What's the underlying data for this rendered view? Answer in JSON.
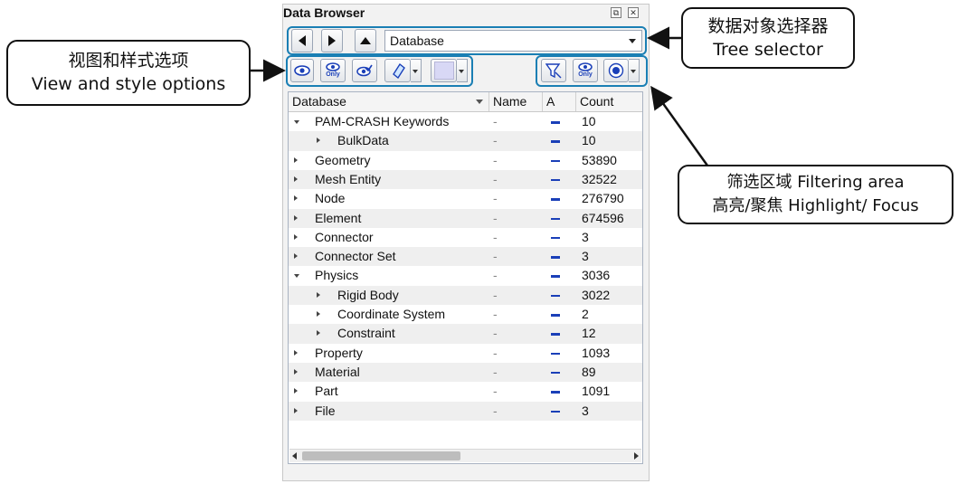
{
  "panel": {
    "title": "Data Browser",
    "restore_glyph": "⧉",
    "close_glyph": "✕"
  },
  "nav": {
    "back_icon": "left-arrow-icon",
    "forward_icon": "right-arrow-icon",
    "up_icon": "up-arrow-icon",
    "selector_value": "Database"
  },
  "toolbar_left": {
    "show_label": "",
    "only_label": "Only",
    "isolate_label": "",
    "style_label": "",
    "color_label": ""
  },
  "toolbar_right": {
    "filter_label": "",
    "only_label": "Only",
    "focus_label": ""
  },
  "table": {
    "headers": {
      "database": "Database",
      "name": "Name",
      "a": "A",
      "count": "Count"
    },
    "rows": [
      {
        "label": "PAM-CRASH Keywords",
        "name": "-",
        "count": "10"
      },
      {
        "label": "BulkData",
        "name": "-",
        "count": "10"
      },
      {
        "label": "Geometry",
        "name": "-",
        "count": "53890"
      },
      {
        "label": "Mesh Entity",
        "name": "-",
        "count": "32522"
      },
      {
        "label": "Node",
        "name": "-",
        "count": "276790"
      },
      {
        "label": "Element",
        "name": "-",
        "count": "674596"
      },
      {
        "label": "Connector",
        "name": "-",
        "count": "3"
      },
      {
        "label": "Connector Set",
        "name": "-",
        "count": "3"
      },
      {
        "label": "Physics",
        "name": "-",
        "count": "3036"
      },
      {
        "label": "Rigid Body",
        "name": "-",
        "count": "3022"
      },
      {
        "label": "Coordinate System",
        "name": "-",
        "count": "2"
      },
      {
        "label": "Constraint",
        "name": "-",
        "count": "12"
      },
      {
        "label": "Property",
        "name": "-",
        "count": "1093"
      },
      {
        "label": "Material",
        "name": "-",
        "count": "89"
      },
      {
        "label": "Part",
        "name": "-",
        "count": "1091"
      },
      {
        "label": "File",
        "name": "-",
        "count": "3"
      }
    ]
  },
  "annotations": {
    "view_options_cn": "视图和样式选项",
    "view_options_en": "View and style options",
    "tree_selector_cn": "数据对象选择器",
    "tree_selector_en": "Tree selector",
    "filter_cn": "筛选区域 Filtering area",
    "filter_en": "高亮/聚焦 Highlight/ Focus"
  },
  "colors": {
    "highlight_box": "#1a7fb4",
    "visibility_bar": "#1a3fb8"
  }
}
